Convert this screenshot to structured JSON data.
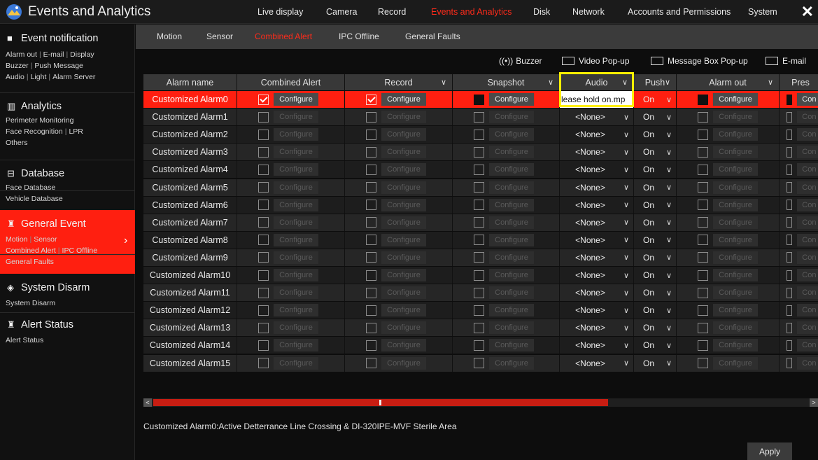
{
  "app": {
    "title": "Events and Analytics",
    "close_symbol": "✕"
  },
  "top_nav": [
    {
      "label": "Live display",
      "active": false
    },
    {
      "label": "Camera",
      "active": false
    },
    {
      "label": "Record",
      "active": false
    },
    {
      "label": "Events and Analytics",
      "active": true
    },
    {
      "label": "Disk",
      "active": false
    },
    {
      "label": "Network",
      "active": false
    },
    {
      "label": "Accounts and Permissions",
      "active": false
    },
    {
      "label": "System",
      "active": false
    }
  ],
  "sidebar": {
    "groups": [
      {
        "icon": "bookmark-icon",
        "title": "Event notification",
        "lines": [
          [
            "Alarm out",
            "E-mail",
            "Display"
          ],
          [
            "Buzzer",
            "Push Message"
          ],
          [
            "Audio",
            "Light",
            "Alarm Server"
          ]
        ]
      },
      {
        "icon": "analytics-icon",
        "title": "Analytics",
        "lines": [
          [
            "Perimeter Monitoring"
          ],
          [
            "Face Recognition",
            "LPR"
          ],
          [
            "Others"
          ]
        ]
      },
      {
        "icon": "database-icon",
        "title": "Database",
        "lines": [
          [
            "Face Database"
          ],
          [
            "Vehicle Database"
          ]
        ]
      },
      {
        "icon": "general-event-icon",
        "title": "General Event",
        "lines": [
          [
            "Motion",
            "Sensor"
          ],
          [
            "Combined Alert",
            "IPC Offline"
          ],
          [
            "General Faults"
          ]
        ]
      },
      {
        "icon": "shield-icon",
        "title": "System Disarm",
        "lines": [
          [
            "System Disarm"
          ]
        ]
      },
      {
        "icon": "alert-icon",
        "title": "Alert Status",
        "lines": [
          [
            "Alert Status"
          ]
        ]
      }
    ],
    "active_group": "General Event"
  },
  "subtabs": [
    {
      "label": "Motion",
      "active": false
    },
    {
      "label": "Sensor",
      "active": false
    },
    {
      "label": "Combined Alert",
      "active": true
    },
    {
      "label": "IPC Offline",
      "active": false
    },
    {
      "label": "General Faults",
      "active": false
    }
  ],
  "toolbar": {
    "buzzer": "Buzzer",
    "video_popup": "Video Pop-up",
    "message_popup": "Message Box Pop-up",
    "email": "E-mail"
  },
  "table": {
    "headers": {
      "name": "Alarm name",
      "combined": "Combined Alert",
      "record": "Record",
      "snapshot": "Snapshot",
      "audio": "Audio",
      "push": "Push",
      "alarm_out": "Alarm out",
      "preset": "Pres"
    },
    "configure_label": "Configure",
    "preset_label": "Con",
    "rows": [
      {
        "name": "Customized Alarm0",
        "combined": true,
        "record": true,
        "snapshot": false,
        "audio": "lease hold on.mp",
        "push": "On",
        "alarm_out": false,
        "preset": false,
        "selected": true
      },
      {
        "name": "Customized Alarm1",
        "combined": false,
        "record": false,
        "snapshot": false,
        "audio": "<None>",
        "push": "On",
        "alarm_out": false,
        "preset": false
      },
      {
        "name": "Customized Alarm2",
        "combined": false,
        "record": false,
        "snapshot": false,
        "audio": "<None>",
        "push": "On",
        "alarm_out": false,
        "preset": false
      },
      {
        "name": "Customized Alarm3",
        "combined": false,
        "record": false,
        "snapshot": false,
        "audio": "<None>",
        "push": "On",
        "alarm_out": false,
        "preset": false
      },
      {
        "name": "Customized Alarm4",
        "combined": false,
        "record": false,
        "snapshot": false,
        "audio": "<None>",
        "push": "On",
        "alarm_out": false,
        "preset": false
      },
      {
        "name": "Customized Alarm5",
        "combined": false,
        "record": false,
        "snapshot": false,
        "audio": "<None>",
        "push": "On",
        "alarm_out": false,
        "preset": false
      },
      {
        "name": "Customized Alarm6",
        "combined": false,
        "record": false,
        "snapshot": false,
        "audio": "<None>",
        "push": "On",
        "alarm_out": false,
        "preset": false
      },
      {
        "name": "Customized Alarm7",
        "combined": false,
        "record": false,
        "snapshot": false,
        "audio": "<None>",
        "push": "On",
        "alarm_out": false,
        "preset": false
      },
      {
        "name": "Customized Alarm8",
        "combined": false,
        "record": false,
        "snapshot": false,
        "audio": "<None>",
        "push": "On",
        "alarm_out": false,
        "preset": false
      },
      {
        "name": "Customized Alarm9",
        "combined": false,
        "record": false,
        "snapshot": false,
        "audio": "<None>",
        "push": "On",
        "alarm_out": false,
        "preset": false
      },
      {
        "name": "Customized Alarm10",
        "combined": false,
        "record": false,
        "snapshot": false,
        "audio": "<None>",
        "push": "On",
        "alarm_out": false,
        "preset": false
      },
      {
        "name": "Customized Alarm11",
        "combined": false,
        "record": false,
        "snapshot": false,
        "audio": "<None>",
        "push": "On",
        "alarm_out": false,
        "preset": false
      },
      {
        "name": "Customized Alarm12",
        "combined": false,
        "record": false,
        "snapshot": false,
        "audio": "<None>",
        "push": "On",
        "alarm_out": false,
        "preset": false
      },
      {
        "name": "Customized Alarm13",
        "combined": false,
        "record": false,
        "snapshot": false,
        "audio": "<None>",
        "push": "On",
        "alarm_out": false,
        "preset": false
      },
      {
        "name": "Customized Alarm14",
        "combined": false,
        "record": false,
        "snapshot": false,
        "audio": "<None>",
        "push": "On",
        "alarm_out": false,
        "preset": false
      },
      {
        "name": "Customized Alarm15",
        "combined": false,
        "record": false,
        "snapshot": false,
        "audio": "<None>",
        "push": "On",
        "alarm_out": false,
        "preset": false
      }
    ]
  },
  "status_text": "Customized Alarm0:Active Detterrance Line Crossing & DI-320IPE-MVF Sterile Area",
  "apply_label": "Apply",
  "colors": {
    "accent": "#ff1f10",
    "highlight_box": "#ffef00",
    "background": "#0d0d0d"
  }
}
